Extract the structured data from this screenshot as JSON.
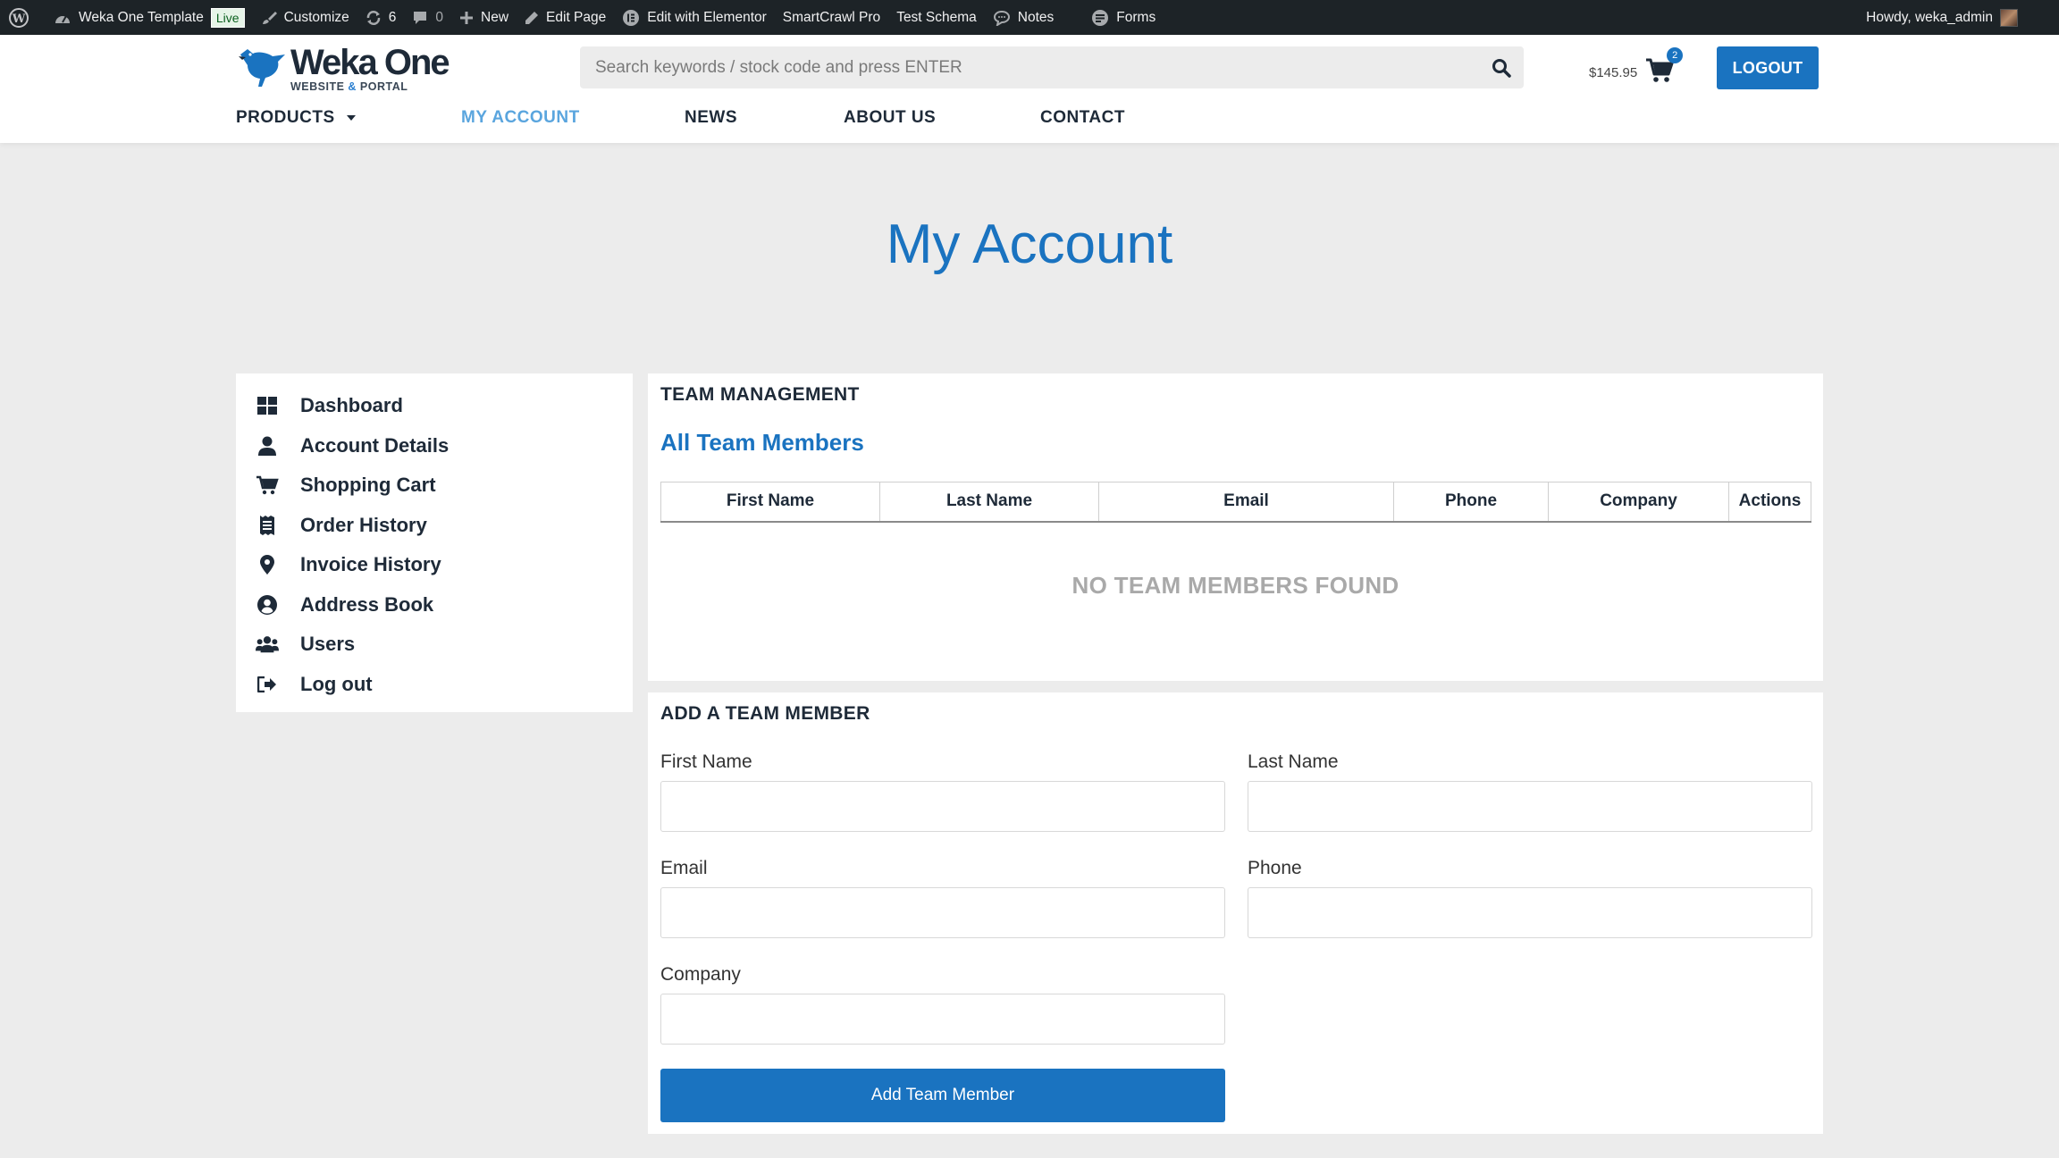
{
  "adminbar": {
    "site_name": "Weka One Template",
    "live_badge": "Live",
    "customize": "Customize",
    "updates_count": "6",
    "comments_count": "0",
    "new": "New",
    "edit_page": "Edit Page",
    "edit_elementor": "Edit with Elementor",
    "smartcrawl": "SmartCrawl Pro",
    "test_schema": "Test Schema",
    "notes": "Notes",
    "forms": "Forms",
    "howdy": "Howdy, weka_admin"
  },
  "header": {
    "logo_main": "Weka One",
    "logo_sub_1": "WEBSITE ",
    "logo_sub_amp": "&",
    "logo_sub_2": " PORTAL",
    "search_placeholder": "Search keywords / stock code and press ENTER",
    "cart_total": "$145.95",
    "cart_count": "2",
    "logout_label": "LOGOUT"
  },
  "nav": {
    "items": [
      {
        "label": "PRODUCTS"
      },
      {
        "label": "MY ACCOUNT"
      },
      {
        "label": "NEWS"
      },
      {
        "label": "ABOUT US"
      },
      {
        "label": "CONTACT"
      }
    ]
  },
  "page_title": "My Account",
  "sidebar": {
    "items": [
      {
        "label": "Dashboard",
        "icon": "dashboard-icon"
      },
      {
        "label": "Account Details",
        "icon": "user-icon"
      },
      {
        "label": "Shopping Cart",
        "icon": "cart-icon"
      },
      {
        "label": "Order History",
        "icon": "receipt-icon"
      },
      {
        "label": "Invoice History",
        "icon": "map-marker-icon"
      },
      {
        "label": "Address Book",
        "icon": "user-circle-icon"
      },
      {
        "label": "Users",
        "icon": "users-icon"
      },
      {
        "label": "Log out",
        "icon": "sign-out-icon"
      }
    ]
  },
  "team": {
    "heading": "TEAM MANAGEMENT",
    "subheading": "All Team Members",
    "columns": [
      "First Name",
      "Last Name",
      "Email",
      "Phone",
      "Company",
      "Actions"
    ],
    "empty_message": "NO TEAM MEMBERS FOUND"
  },
  "add_form": {
    "heading": "ADD A TEAM MEMBER",
    "first_name_label": "First Name",
    "last_name_label": "Last Name",
    "email_label": "Email",
    "phone_label": "Phone",
    "company_label": "Company",
    "first_name_value": "",
    "last_name_value": "",
    "email_value": "",
    "phone_value": "",
    "company_value": "",
    "submit_label": "Add Team Member"
  },
  "colors": {
    "primary": "#1a73c0",
    "nav_active": "#5aa5de",
    "admin_bar": "#1d2327",
    "page_bg": "#ececec"
  }
}
